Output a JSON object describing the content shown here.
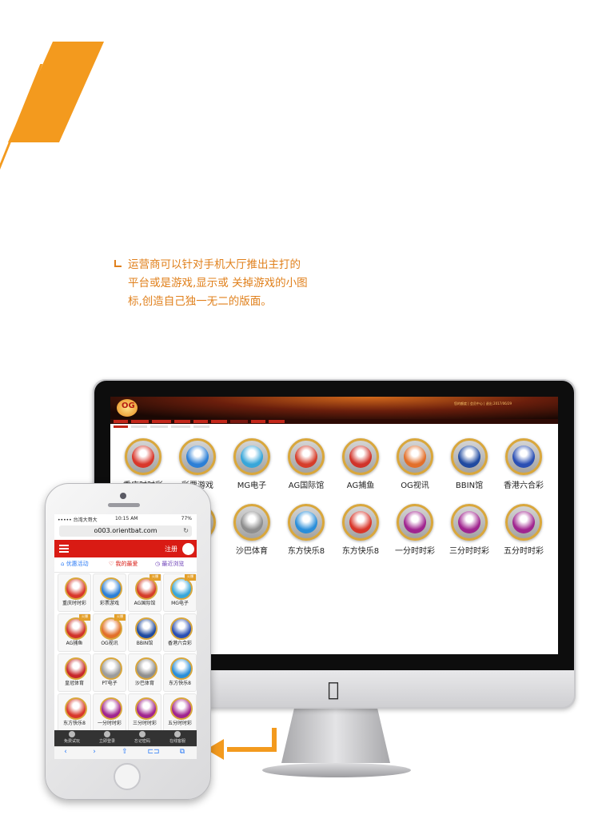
{
  "caption": {
    "line1": "运营商可以针对手机大厅推出主打的",
    "line2": "平台或是游戏,显示或 关掉游戏的小图",
    "line3": "标,创造自己独一无二的版面。"
  },
  "colors": {
    "accent": "#f39a1e",
    "brand_red": "#d91b14",
    "caption": "#e0801c"
  },
  "desktop": {
    "logo_text": "OG",
    "top_info": "您的额度 | 会员中心 | 退出 2017/06/29",
    "games": [
      {
        "label": "重庆时时彩",
        "color": "#d8372b"
      },
      {
        "label": "彩票游戏",
        "color": "#2c7fd6"
      },
      {
        "label": "MG电子",
        "color": "#38a6d9"
      },
      {
        "label": "AG国际馆",
        "color": "#d53d2a"
      },
      {
        "label": "AG捕鱼",
        "color": "#d0332a"
      },
      {
        "label": "OG视讯",
        "color": "#e26f2a"
      },
      {
        "label": "BBIN馆",
        "color": "#1f4aa0"
      },
      {
        "label": "香港六合彩",
        "color": "#2a4fb3"
      },
      {
        "label": "皇冠体育",
        "color": "#c7282b"
      },
      {
        "label": "PT电子",
        "color": "#9b9b9b"
      },
      {
        "label": "沙巴体育",
        "color": "#8e8e8e"
      },
      {
        "label": "东方快乐8",
        "color": "#2a8ed9"
      },
      {
        "label": "东方快乐8",
        "color": "#d8372b"
      },
      {
        "label": "一分时时彩",
        "color": "#a0258f"
      },
      {
        "label": "三分时时彩",
        "color": "#a0258f"
      },
      {
        "label": "五分时时彩",
        "color": "#a0258f"
      }
    ],
    "partial_label_row1": "游戏"
  },
  "phone": {
    "status_left": "••••• 台湾大哥大 ",
    "status_time": "10:15 AM",
    "status_right": "77%",
    "url": "o003.orientbat.com",
    "register": "注册",
    "tabs": [
      "优惠活动",
      "我的最爱",
      "最近浏览"
    ],
    "games": [
      {
        "label": "重庆时时彩",
        "color": "#d8372b"
      },
      {
        "label": "彩票游戏",
        "color": "#2c7fd6"
      },
      {
        "label": "AG国际馆",
        "color": "#d53d2a",
        "ribbon": "火爆"
      },
      {
        "label": "MG电子",
        "color": "#38a6d9",
        "ribbon": "火爆"
      },
      {
        "label": "AG捕鱼",
        "color": "#d0332a",
        "ribbon": "火爆"
      },
      {
        "label": "OG视讯",
        "color": "#e26f2a",
        "ribbon": "火爆"
      },
      {
        "label": "BBIN馆",
        "color": "#1f4aa0"
      },
      {
        "label": "香港六合彩",
        "color": "#2a4fb3"
      },
      {
        "label": "皇冠体育",
        "color": "#c7282b"
      },
      {
        "label": "PT电子",
        "color": "#9b9b9b"
      },
      {
        "label": "沙巴体育",
        "color": "#8e8e8e"
      },
      {
        "label": "东方快乐8",
        "color": "#2a8ed9"
      },
      {
        "label": "东方快乐8",
        "color": "#d8372b"
      },
      {
        "label": "一分时时彩",
        "color": "#a0258f"
      },
      {
        "label": "三分时时彩",
        "color": "#a0258f"
      },
      {
        "label": "五分时时彩",
        "color": "#a0258f"
      }
    ],
    "bottom_nav": [
      "免费试玩",
      "立即登录",
      "忘记密码",
      "在线客服"
    ],
    "safari_icons": [
      "‹",
      "›",
      "⇧",
      "⊏⊐",
      "⧉"
    ]
  }
}
